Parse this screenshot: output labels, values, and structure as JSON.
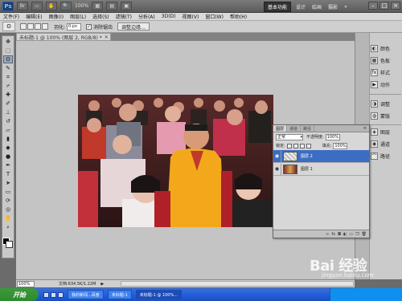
{
  "app": {
    "logo": "Ps",
    "zoom": "100%"
  },
  "workspace": {
    "active": "基本功能",
    "items": [
      "设计",
      "绘画",
      "摄影"
    ]
  },
  "menu": [
    "文件(F)",
    "编辑(E)",
    "图像(I)",
    "图层(L)",
    "选择(S)",
    "滤镜(T)",
    "分析(A)",
    "3D(D)",
    "视图(V)",
    "窗口(W)",
    "帮助(H)"
  ],
  "options": {
    "feather_label": "羽化:",
    "feather_value": "0 px",
    "antialias_label": "消除锯齿",
    "refine_edge": "调整边缘..."
  },
  "document": {
    "tab_title": "未标题-1 @ 100% (图层 2, RGB/8) *"
  },
  "dock": {
    "items": [
      {
        "label": "颜色",
        "icon": "color-icon"
      },
      {
        "label": "色板",
        "icon": "swatches-icon"
      },
      {
        "label": "样式",
        "icon": "styles-icon"
      },
      {
        "label": "动作",
        "icon": "actions-icon"
      },
      {
        "label": "调整",
        "icon": "adjustments-icon"
      },
      {
        "label": "蒙版",
        "icon": "masks-icon"
      },
      {
        "label": "图层",
        "icon": "layers-icon"
      },
      {
        "label": "通道",
        "icon": "channels-icon"
      },
      {
        "label": "路径",
        "icon": "paths-icon"
      }
    ]
  },
  "layers_panel": {
    "tabs": [
      "图层",
      "通道",
      "路径"
    ],
    "blend_mode": "正常",
    "opacity_label": "不透明度:",
    "opacity_value": "100%",
    "lock_label": "锁定:",
    "fill_label": "填充:",
    "fill_value": "100%",
    "layers": [
      {
        "name": "图层 2",
        "selected": true
      },
      {
        "name": "图层 1",
        "selected": false
      }
    ]
  },
  "status": {
    "zoom": "100%",
    "doc": "文档:634.5K/1.22M"
  },
  "taskbar": {
    "start": "开始",
    "tasks": [
      "我的新闻...百度",
      "未标题-1",
      "未标题-1 @ 100%..."
    ]
  },
  "watermark": {
    "brand": "Bai 经验",
    "url": "jingyan.baidu.com"
  }
}
